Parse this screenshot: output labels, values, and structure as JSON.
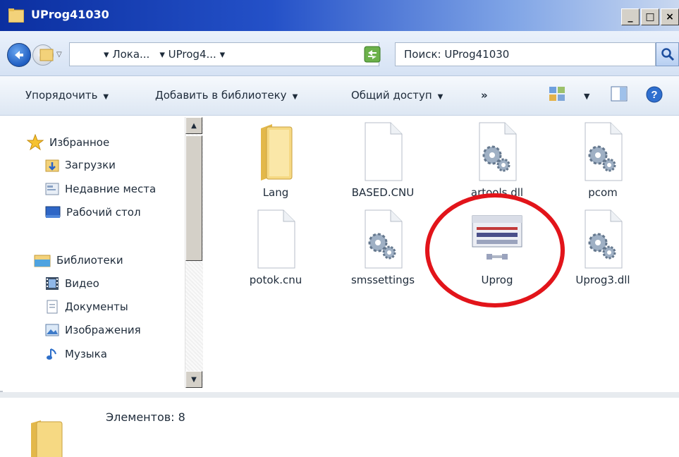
{
  "window": {
    "title": "UProg41030",
    "min_label": "_",
    "max_label": "□",
    "close_label": "×"
  },
  "address": {
    "crumbs": [
      "Лока...",
      "UProg4..."
    ],
    "search_placeholder": "Поиск: UProg41030"
  },
  "toolbar": {
    "organize_label": "Упорядочить",
    "add_library_label": "Добавить в библиотеку",
    "share_label": "Общий доступ",
    "more_label": "»"
  },
  "navigation": {
    "favorites_label": "Избранное",
    "favorites_items": [
      "Загрузки",
      "Недавние места",
      "Рабочий стол"
    ],
    "libraries_label": "Библиотеки",
    "libraries_items": [
      "Видео",
      "Документы",
      "Изображения",
      "Музыка"
    ]
  },
  "files": [
    {
      "name": "Lang",
      "icon": "folder-icon"
    },
    {
      "name": "BASED.CNU",
      "icon": "blank-file-icon"
    },
    {
      "name": "artools.dll",
      "icon": "gear-file-icon"
    },
    {
      "name": "pcom",
      "icon": "gear-file-icon"
    },
    {
      "name": "potok.cnu",
      "icon": "blank-file-icon"
    },
    {
      "name": "smssettings",
      "icon": "gear-file-icon"
    },
    {
      "name": "Uprog",
      "icon": "app-icon"
    },
    {
      "name": "Uprog3.dll",
      "icon": "gear-file-icon"
    }
  ],
  "details": {
    "count_text": "Элементов: 8"
  },
  "colors": {
    "highlight": "#e2141a",
    "title_bar": "#0b2fa0"
  }
}
